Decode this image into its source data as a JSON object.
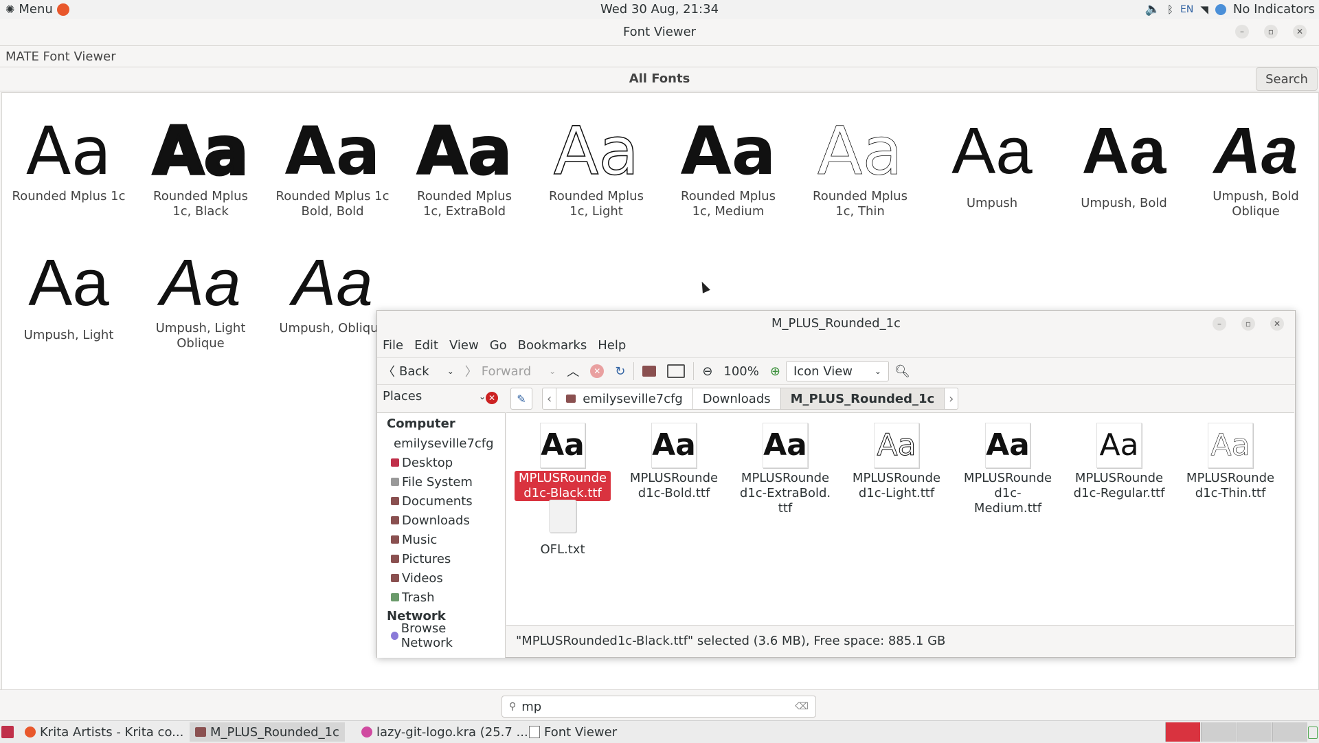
{
  "topbar": {
    "menu_label": "Menu",
    "datetime": "Wed 30 Aug, 21:34",
    "lang": "EN",
    "indicators_label": "No Indicators",
    "icons": [
      "volume-icon",
      "bluetooth-icon",
      "wifi-icon",
      "user-icon"
    ]
  },
  "window": {
    "title": "Font Viewer",
    "app_name": "MATE Font Viewer",
    "tab_title": "All Fonts",
    "search_label": "Search"
  },
  "fonts": [
    {
      "sample": "Aa",
      "label": "Rounded Mplus 1c"
    },
    {
      "sample": "Aa",
      "label": "Rounded Mplus 1c, Black"
    },
    {
      "sample": "Aa",
      "label": "Rounded Mplus 1c Bold, Bold"
    },
    {
      "sample": "Aa",
      "label": "Rounded Mplus 1c, ExtraBold"
    },
    {
      "sample": "Aa",
      "label": "Rounded Mplus 1c, Light"
    },
    {
      "sample": "Aa",
      "label": "Rounded Mplus 1c, Medium"
    },
    {
      "sample": "Aa",
      "label": "Rounded Mplus 1c, Thin"
    },
    {
      "sample": "Aa",
      "label": "Umpush"
    },
    {
      "sample": "Aa",
      "label": "Umpush, Bold"
    },
    {
      "sample": "Aa",
      "label": "Umpush, Bold Oblique"
    },
    {
      "sample": "Aa",
      "label": "Umpush, Light"
    },
    {
      "sample": "Aa",
      "label": "Umpush, Light Oblique"
    },
    {
      "sample": "Aa",
      "label": "Umpush, Oblique"
    }
  ],
  "filemanager": {
    "title": "M_PLUS_Rounded_1c",
    "menu": [
      "File",
      "Edit",
      "View",
      "Go",
      "Bookmarks",
      "Help"
    ],
    "toolbar": {
      "back": "Back",
      "forward": "Forward",
      "zoom": "100%",
      "view_mode": "Icon View"
    },
    "places_label": "Places",
    "breadcrumbs": [
      "emilyseville7cfg",
      "Downloads",
      "M_PLUS_Rounded_1c"
    ],
    "sidebar": {
      "computer_header": "Computer",
      "computer_items": [
        "emilyseville7cfg",
        "Desktop",
        "File System",
        "Documents",
        "Downloads",
        "Music",
        "Pictures",
        "Videos",
        "Trash"
      ],
      "network_header": "Network",
      "network_items": [
        "Browse Network"
      ]
    },
    "files": [
      {
        "name": "MPLUSRounded1c-Black.ttf",
        "line1": "MPLUSRounde",
        "line2": "d1c-Black.ttf",
        "line3": "",
        "glyph": "Aa",
        "selected": true
      },
      {
        "name": "MPLUSRounded1c-Bold.ttf",
        "line1": "MPLUSRounde",
        "line2": "d1c-Bold.ttf",
        "line3": "",
        "glyph": "Aa"
      },
      {
        "name": "MPLUSRounded1c-ExtraBold.ttf",
        "line1": "MPLUSRounde",
        "line2": "d1c-ExtraBold.",
        "line3": "ttf",
        "glyph": "Aa"
      },
      {
        "name": "MPLUSRounded1c-Light.ttf",
        "line1": "MPLUSRounde",
        "line2": "d1c-Light.ttf",
        "line3": "",
        "glyph": "Aa"
      },
      {
        "name": "MPLUSRounded1c-Medium.ttf",
        "line1": "MPLUSRounde",
        "line2": "d1c-Medium.ttf",
        "line3": "",
        "glyph": "Aa"
      },
      {
        "name": "MPLUSRounded1c-Regular.ttf",
        "line1": "MPLUSRounde",
        "line2": "d1c-Regular.ttf",
        "line3": "",
        "glyph": "Aa"
      },
      {
        "name": "MPLUSRounded1c-Thin.ttf",
        "line1": "MPLUSRounde",
        "line2": "d1c-Thin.ttf",
        "line3": "",
        "glyph": "Aa"
      },
      {
        "name": "OFL.txt",
        "line1": "OFL.txt",
        "line2": "",
        "line3": "",
        "glyph": ""
      }
    ],
    "status": "\"MPLUSRounded1c-Black.ttf\" selected (3.6 MB), Free space: 885.1 GB"
  },
  "search_query": "mp",
  "taskbar": [
    {
      "label": "Krita Artists - Krita co..."
    },
    {
      "label": "M_PLUS_Rounded_1c"
    },
    {
      "label": "lazy-git-logo.kra (25.7 ..."
    },
    {
      "label": "Font Viewer"
    }
  ],
  "colors": {
    "selection": "#d9333f",
    "accent": "#3465a4"
  }
}
